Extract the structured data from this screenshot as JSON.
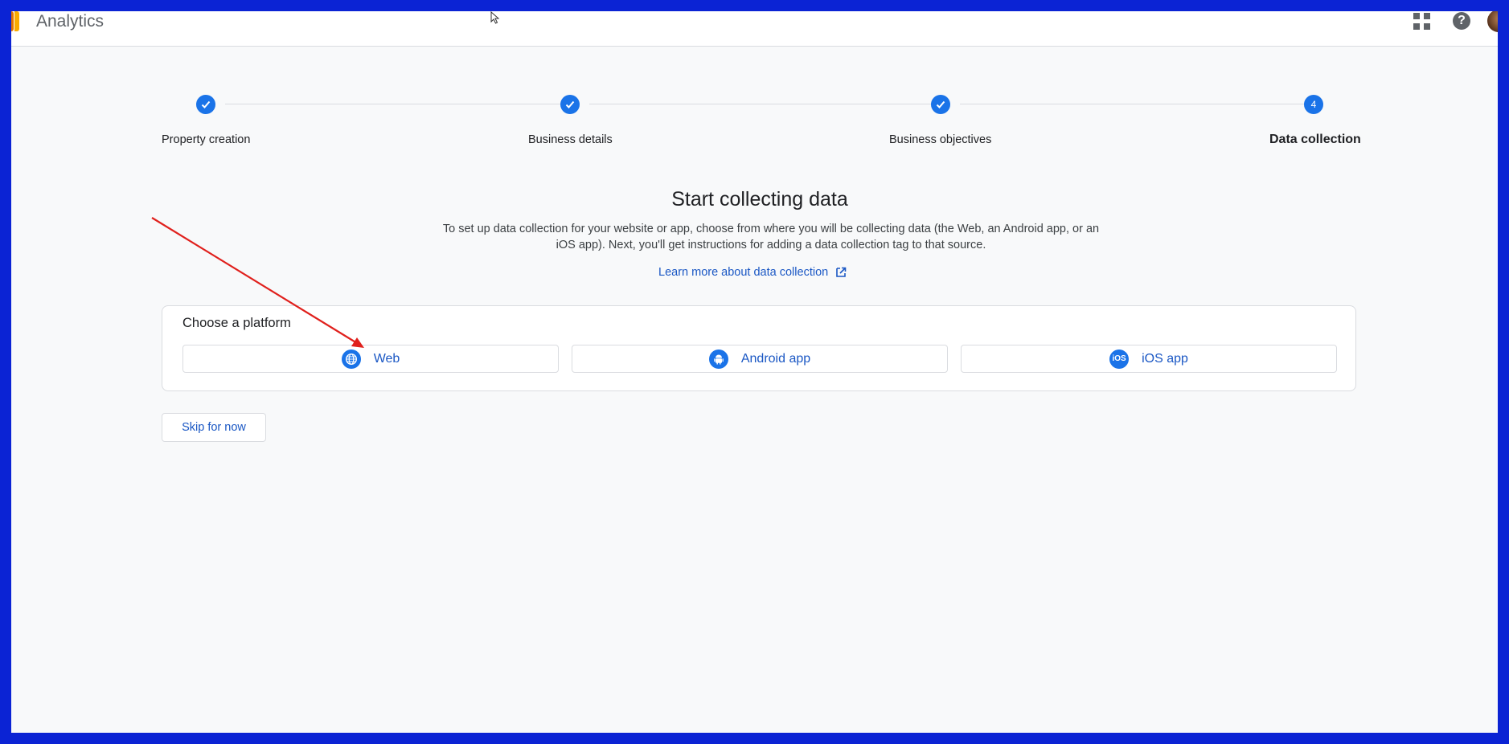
{
  "header": {
    "app_title": "Analytics",
    "apps_icon": "apps-grid-icon",
    "help_icon": "help-icon",
    "help_glyph": "?"
  },
  "stepper": {
    "steps": [
      {
        "label": "Property creation",
        "state": "completed",
        "marker": "check-icon"
      },
      {
        "label": "Business details",
        "state": "completed",
        "marker": "check-icon"
      },
      {
        "label": "Business objectives",
        "state": "completed",
        "marker": "check-icon"
      },
      {
        "label": "Data collection",
        "state": "active",
        "number": "4"
      }
    ]
  },
  "main": {
    "heading": "Start collecting data",
    "description": "To set up data collection for your website or app, choose from where you will be collecting data (the Web, an Android app, or an iOS app). Next, you'll get instructions for adding a data collection tag to that source.",
    "learn_more": "Learn more about data collection",
    "learn_more_icon": "open-in-new-icon"
  },
  "platform": {
    "title": "Choose a platform",
    "options": [
      {
        "label": "Web",
        "icon": "globe-icon"
      },
      {
        "label": "Android app",
        "icon": "android-icon"
      },
      {
        "label": "iOS app",
        "icon": "ios-icon",
        "icon_text": "iOS"
      }
    ]
  },
  "skip_label": "Skip for now",
  "colors": {
    "accent": "#1a73e8",
    "link": "#1a57c4",
    "annotation_arrow": "#e0201c",
    "frame_border": "#0b23d4"
  }
}
